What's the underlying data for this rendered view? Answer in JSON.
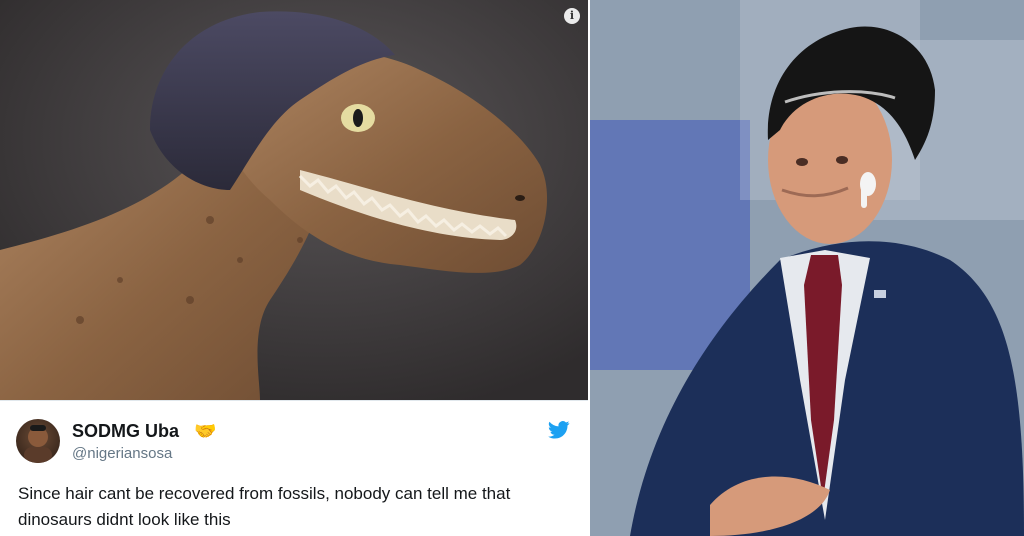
{
  "tweet": {
    "display_name": "SODMG Uba",
    "verified_emoji": "🤝",
    "handle": "@nigeriansosa",
    "text": "Since hair cant be recovered from fossils, nobody can tell me that dinosaurs didnt look like this"
  },
  "icons": {
    "info": "info-icon",
    "twitter": "twitter-bird-icon",
    "verified": "handshake-icon"
  },
  "colors": {
    "twitter_blue": "#1da1f2",
    "text_primary": "#14171a",
    "text_secondary": "#657786",
    "suit_blue": "#1c2f59",
    "tie_red": "#7a1a2a"
  }
}
